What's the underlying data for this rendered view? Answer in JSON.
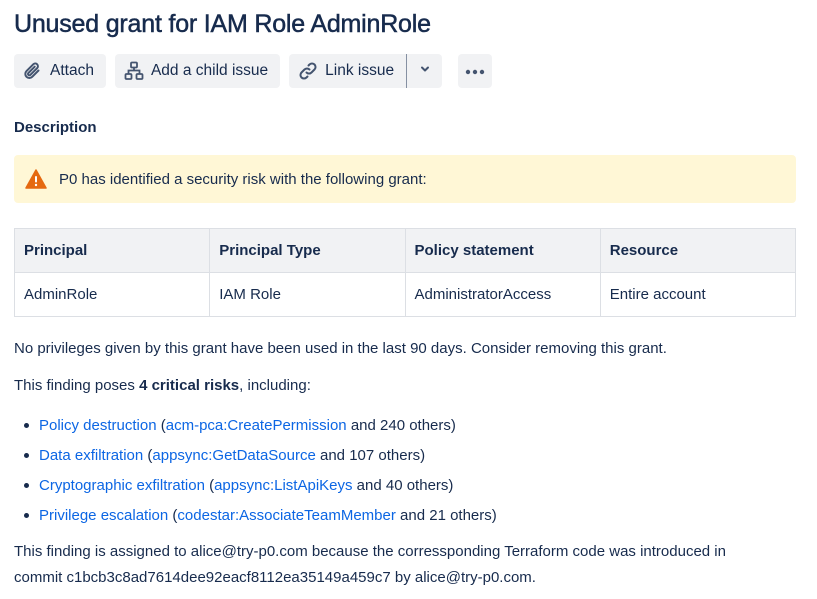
{
  "issue": {
    "title": "Unused grant for IAM Role AdminRole"
  },
  "toolbar": {
    "attach_label": "Attach",
    "child_issue_label": "Add a child issue",
    "link_issue_label": "Link issue"
  },
  "description": {
    "label": "Description",
    "panel_text": "P0 has identified a security risk with the following grant:",
    "table": {
      "headers": [
        "Principal",
        "Principal Type",
        "Policy statement",
        "Resource"
      ],
      "rows": [
        [
          "AdminRole",
          "IAM Role",
          "AdministratorAccess",
          "Entire account"
        ]
      ]
    },
    "unused_text": "No privileges given by this grant have been used in the last 90 days. Consider removing this grant.",
    "finding_prefix": "This finding poses ",
    "finding_count": "4 critical risks",
    "finding_suffix": ", including:",
    "risks": [
      {
        "name": "Policy destruction",
        "example": "acm-pca:CreatePermission",
        "others": "and 240 others)"
      },
      {
        "name": "Data exfiltration",
        "example": "appsync:GetDataSource",
        "others": "and 107 others)"
      },
      {
        "name": "Cryptographic exfiltration",
        "example": "appsync:ListApiKeys",
        "others": "and 40 others)"
      },
      {
        "name": "Privilege escalation",
        "example": "codestar:AssociateTeamMember",
        "others": "and 21 others)"
      }
    ],
    "assigned_line1": "This finding is assigned to alice@try-p0.com because the corressponding Terraform code was introduced in",
    "assigned_line2": "commit c1bcb3c8ad7614dee92eacf8112ea35149a459c7 by alice@try-p0.com."
  },
  "colors": {
    "text": "#172b4d",
    "link": "#0c66e4",
    "button_bg": "#f1f2f4",
    "panel_bg": "#fff7d6",
    "warning": "#e56910"
  },
  "icons": {
    "attach": "paperclip-icon",
    "child_issue": "hierarchy-icon",
    "link_issue": "link-icon",
    "dropdown": "chevron-down-icon",
    "more": "more-icon",
    "warning": "warning-icon"
  }
}
